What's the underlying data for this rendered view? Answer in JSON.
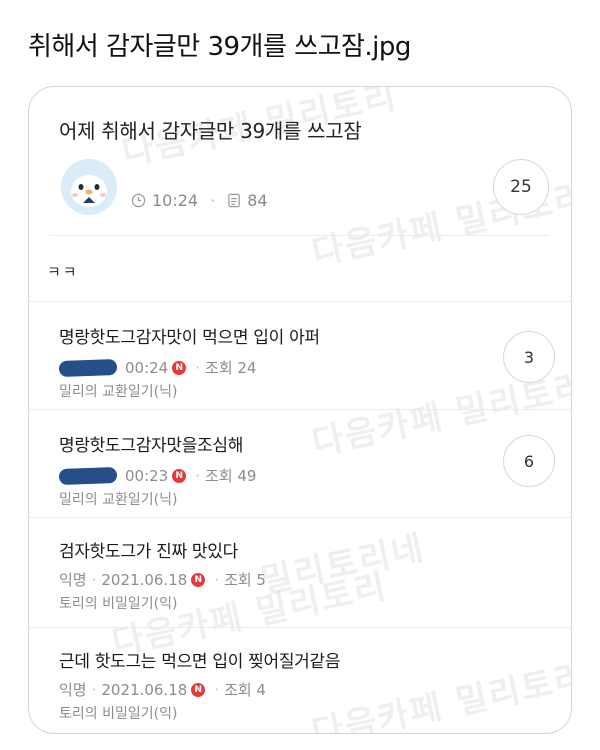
{
  "page": {
    "title": "취해서 감자글만 39개를 쓰고잠.jpg"
  },
  "post": {
    "title": "어제 취해서 감자글만 39개를 쓰고잠",
    "time": "10:24",
    "views": "84",
    "comment_count": "25",
    "body": "ㅋㅋ"
  },
  "items": [
    {
      "title": "명랑핫도그감자맛이 먹으면 입이 아퍼",
      "date": "00:24",
      "new_badge": "N",
      "views": "조회 24",
      "board": "밀리의 교환일기(닉)",
      "comments": "3"
    },
    {
      "title": "명랑핫도그감자맛을조심해",
      "date": "00:23",
      "new_badge": "N",
      "views": "조회 49",
      "board": "밀리의 교환일기(닉)",
      "comments": "6"
    },
    {
      "title": "검자핫도그가 진짜 맛있다",
      "author": "익명",
      "date": "2021.06.18",
      "new_badge": "N",
      "views": "조회 5",
      "board": "토리의 비밀일기(익)"
    },
    {
      "title": "근데 핫도그는 먹으면 입이 찢어질거같음",
      "author": "익명",
      "date": "2021.06.18",
      "new_badge": "N",
      "views": "조회 4",
      "board": "토리의 비밀일기(익)"
    }
  ],
  "watermark": {
    "text_a": "다음카페 밀리토리",
    "text_b": "밀리토리네"
  },
  "colors": {
    "accent_red": "#e23b3b",
    "redaction": "#254f86",
    "muted": "#8d8d8d"
  }
}
